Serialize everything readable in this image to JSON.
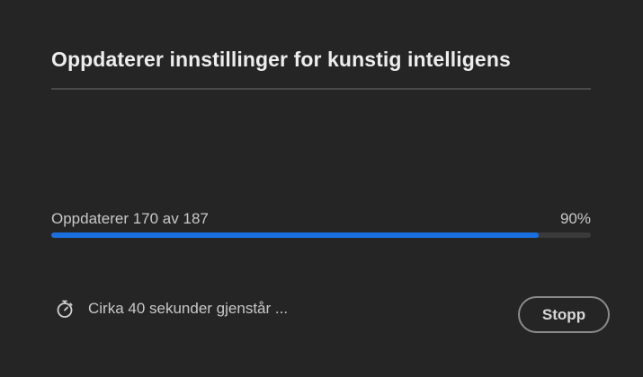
{
  "dialog": {
    "title": "Oppdaterer innstillinger for kunstig intelligens"
  },
  "progress": {
    "label": "Oppdaterer 170 av 187",
    "current": 170,
    "total": 187,
    "percent_label": "90%",
    "fraction": 0.904
  },
  "status": {
    "icon": "stopwatch-icon",
    "text": "Cirka 40 sekunder gjenstår ..."
  },
  "actions": {
    "stop_label": "Stopp"
  },
  "colors": {
    "background": "#252525",
    "progress_fill": "#1a6fe0",
    "progress_track": "#3a3a3a"
  }
}
